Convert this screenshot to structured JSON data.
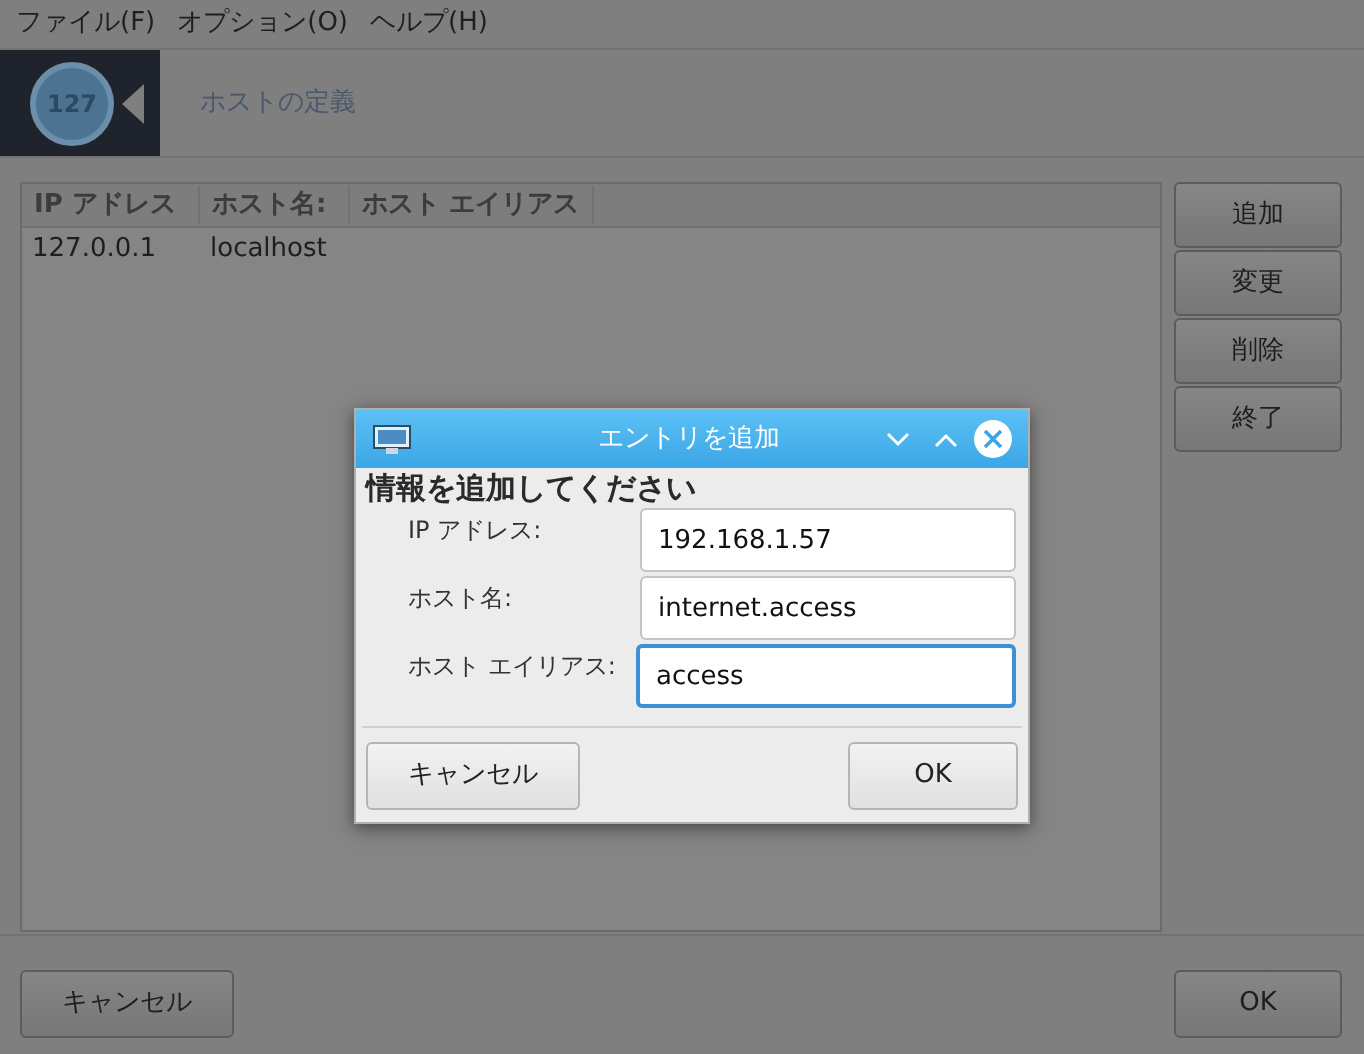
{
  "menu": [
    "ファイル(F)",
    "オプション(O)",
    "ヘルプ(H)"
  ],
  "header": {
    "logo_text": "127",
    "title": "ホストの定義"
  },
  "table": {
    "columns": [
      "IP アドレス",
      "ホスト名:",
      "ホスト エイリアス"
    ],
    "rows": [
      {
        "cells": [
          "127.0.0.1",
          "localhost",
          ""
        ],
        "selected": false
      }
    ]
  },
  "side_buttons": [
    "追加",
    "変更",
    "削除",
    "終了"
  ],
  "bottom_buttons": [
    "キャンセル",
    "OK"
  ],
  "dialog": {
    "title": "エントリを追加",
    "heading": "情報を追加してください",
    "fields": [
      {
        "label": "IP アドレス:",
        "value": "192.168.1.57",
        "focused": false
      },
      {
        "label": "ホスト名:",
        "value": "internet.access",
        "focused": false
      },
      {
        "label": "ホスト エイリアス:",
        "value": "access",
        "focused": true
      }
    ],
    "buttons": [
      "キャンセル",
      "OK"
    ]
  }
}
